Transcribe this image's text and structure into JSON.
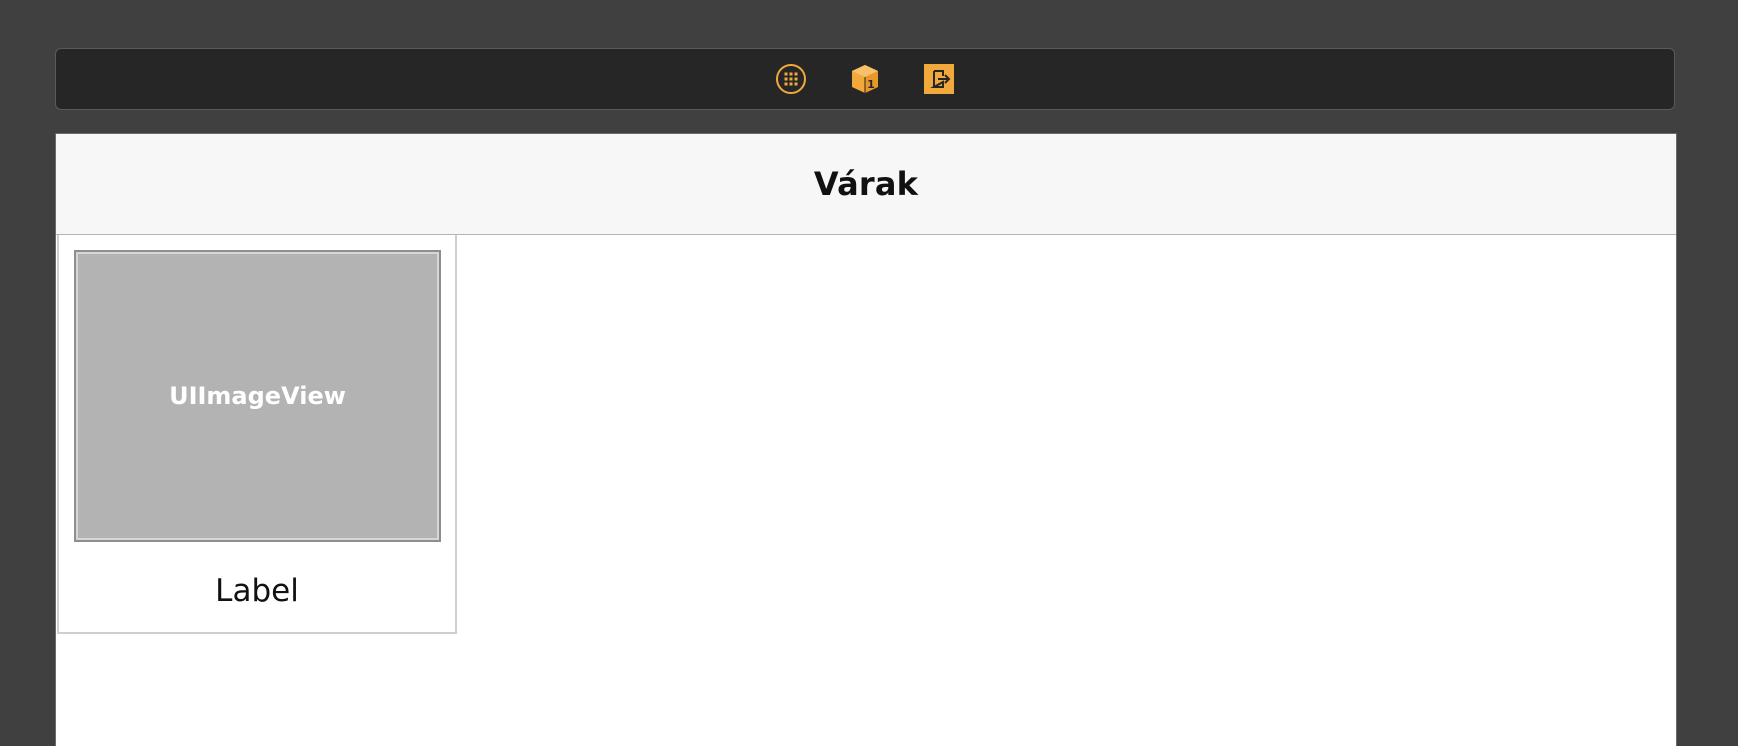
{
  "dock": {
    "icons": [
      {
        "name": "view-controller-icon",
        "color": "#f2a93b"
      },
      {
        "name": "first-responder-icon",
        "color": "#f2a93b",
        "badge": "1"
      },
      {
        "name": "exit-icon",
        "color": "#f2a93b"
      }
    ]
  },
  "scene": {
    "nav_title": "Várak",
    "cell": {
      "image_view_text": "UIImageView",
      "label": "Label"
    }
  },
  "colors": {
    "canvas_bg": "#404040",
    "dock_bg": "#262626",
    "accent": "#f2a93b",
    "nav_bg": "#f7f7f7",
    "image_placeholder": "#b3b3b3"
  }
}
